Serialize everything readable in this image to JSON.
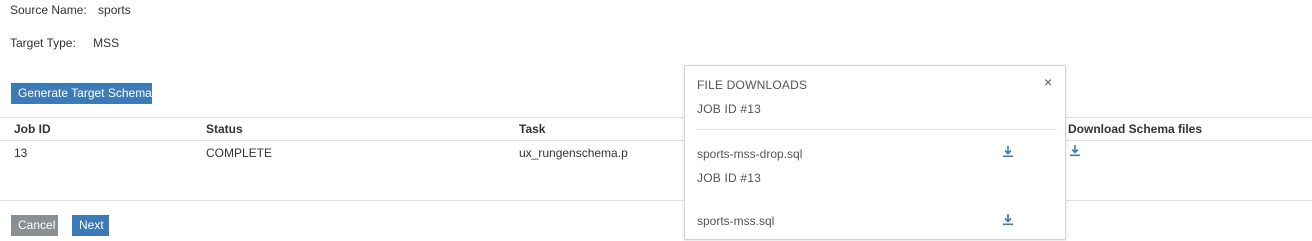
{
  "source": {
    "label": "Source Name:",
    "value": "sports"
  },
  "target": {
    "label": "Target Type:",
    "value": "MSS"
  },
  "generate_button": "Generate Target Schema",
  "table": {
    "columns": [
      "Job ID",
      "Status",
      "Task",
      "Download Schema files"
    ],
    "rows": [
      {
        "job_id": "13",
        "status": "COMPLETE",
        "task": "ux_rungenschema.p"
      }
    ]
  },
  "footer": {
    "cancel": "Cancel",
    "next": "Next"
  },
  "popover": {
    "title": "FILE DOWNLOADS",
    "close": "×",
    "groups": [
      {
        "job": "JOB ID #13",
        "file": "sports-mss-drop.sql"
      },
      {
        "job": "JOB ID #13",
        "file": "sports-mss.sql"
      }
    ]
  },
  "icons": {
    "download": "download-icon",
    "close": "close-icon"
  },
  "colors": {
    "primary": "#3d7ab8",
    "secondary": "#8a8f94"
  }
}
